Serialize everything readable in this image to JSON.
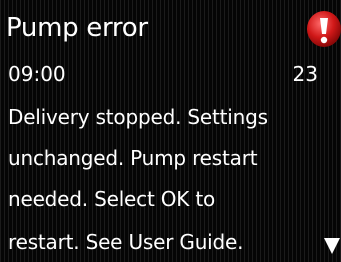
{
  "screen": {
    "title": "Pump error",
    "time": "09:00",
    "error_code": "23",
    "message_lines": [
      "Delivery stopped. Settings",
      "unchanged. Pump restart",
      "needed. Select OK to",
      "restart. See User Guide."
    ]
  },
  "icons": {
    "alert": "exclamation-alert-icon",
    "scroll": "scroll-down-arrow-icon"
  },
  "colors": {
    "background": "#050505",
    "text": "#ffffff",
    "alert": "#d01818"
  }
}
